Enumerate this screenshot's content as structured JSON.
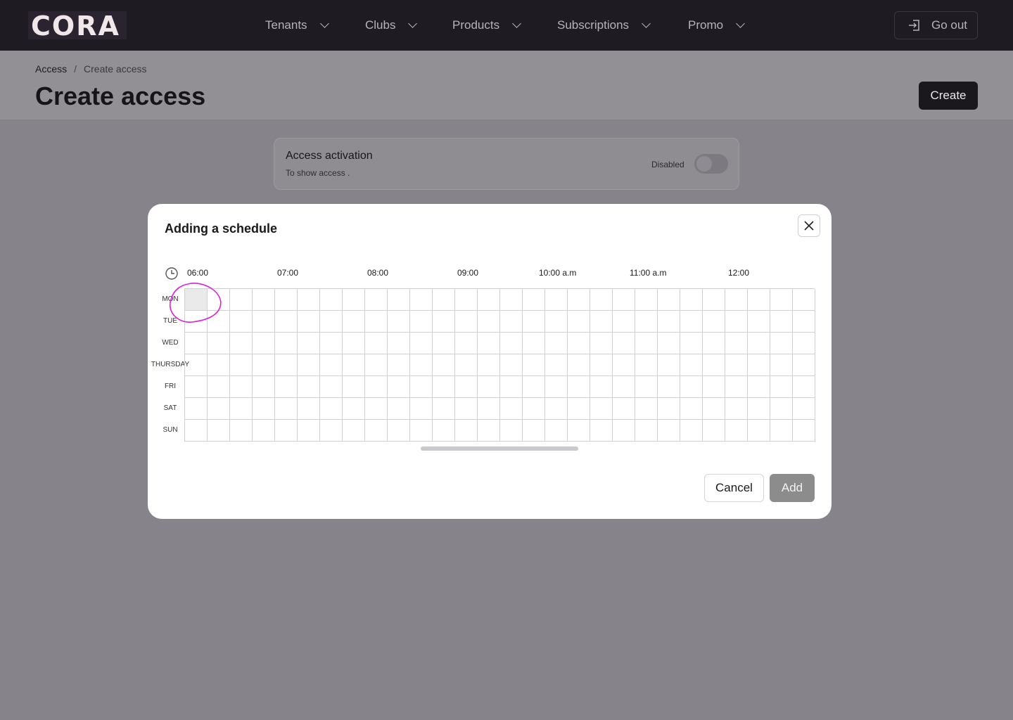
{
  "app": {
    "logo": "CORA"
  },
  "nav": {
    "items": [
      "Tenants",
      "Clubs",
      "Products",
      "Subscriptions",
      "Promo"
    ],
    "go_out": "Go out"
  },
  "breadcrumb": {
    "parent": "Access",
    "separator": "/",
    "current": "Create access"
  },
  "page": {
    "title": "Create access",
    "create_button": "Create"
  },
  "access_card": {
    "title": "Access activation",
    "subtitle": "To show access .",
    "toggle_label": "Disabled",
    "toggle_on": false
  },
  "modal": {
    "title": "Adding a schedule",
    "time_labels": [
      "06:00",
      "07:00",
      "08:00",
      "09:00",
      "10:00 a.m",
      "11:00 a.m",
      "12:00"
    ],
    "days": [
      "MON",
      "TUE",
      "WED",
      "THURSDAY",
      "FRI",
      "SAT",
      "SUN"
    ],
    "selected_cell": {
      "day": "MON",
      "time": "06:00"
    },
    "cancel_label": "Cancel",
    "add_label": "Add"
  },
  "colors": {
    "accent_dark": "#1a181c",
    "annotation": "#e020d8",
    "add_disabled": "#8c8c8c"
  }
}
